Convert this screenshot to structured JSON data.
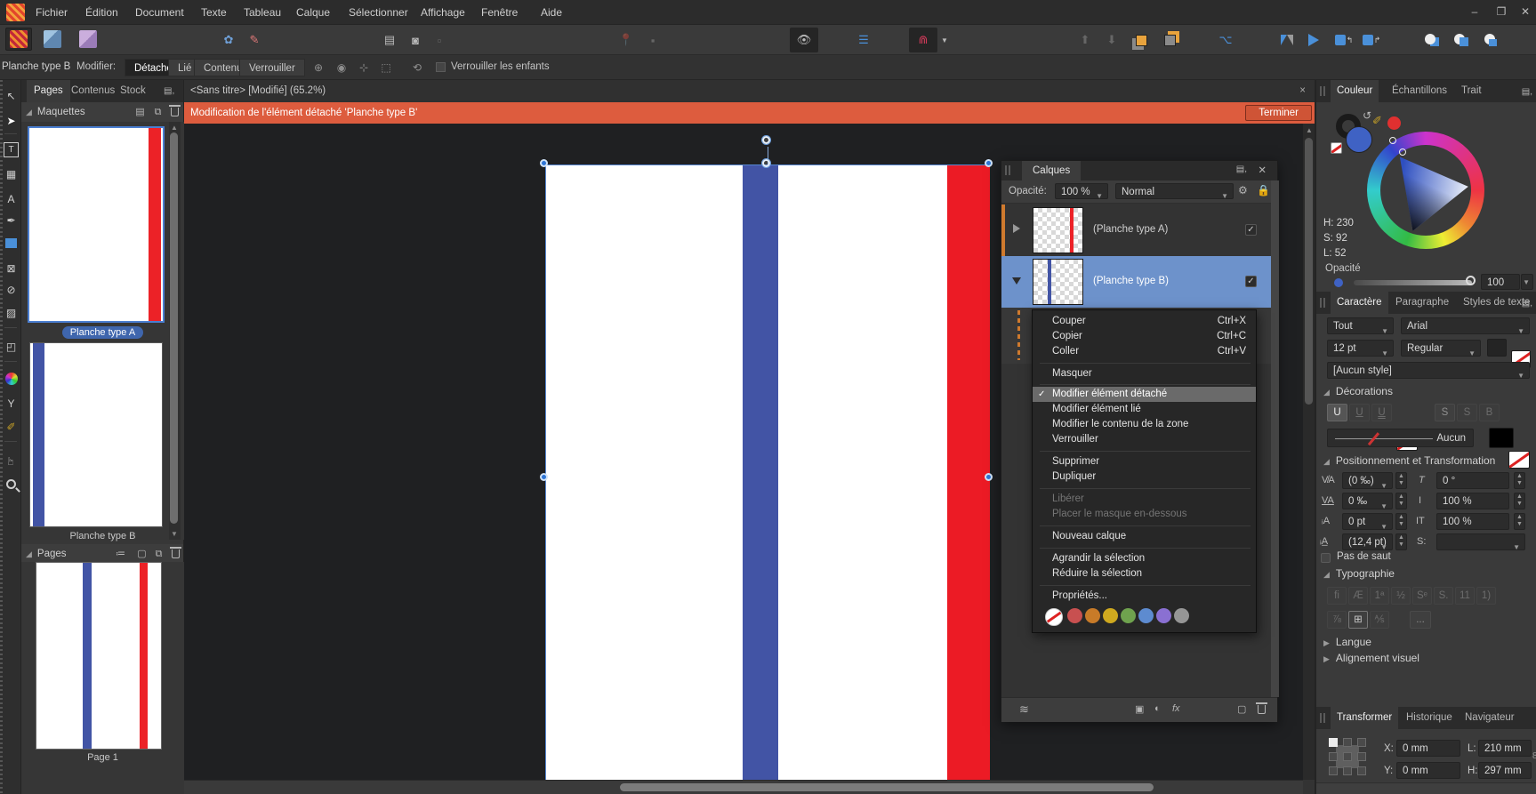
{
  "menubar": {
    "items": [
      "Fichier",
      "Édition",
      "Document",
      "Texte",
      "Tableau",
      "Calque",
      "Sélectionner",
      "Affichage",
      "Fenêtre",
      "Aide"
    ]
  },
  "window_controls": {
    "minimize": "–",
    "restore": "❐",
    "close": "✕"
  },
  "context_toolbar": {
    "title": "Planche type B",
    "modifier_label": "Modifier:",
    "detache": "Détaché",
    "lie": "Lié",
    "contenu": "Contenu",
    "verrouiller": "Verrouiller",
    "lock_children": "Verrouiller les enfants"
  },
  "left_panel": {
    "tabs": [
      "Pages",
      "Contenus",
      "Stock"
    ],
    "maquettes_title": "Maquettes",
    "master_a": "Planche type A",
    "master_b": "Planche type B",
    "pages_title": "Pages",
    "page1": "Page 1"
  },
  "document": {
    "tab_title": "<Sans titre> [Modifié] (65.2%)",
    "banner_text": "Modification de l'élément détaché 'Planche type B'",
    "banner_button": "Terminer"
  },
  "layers_panel": {
    "title": "Calques",
    "opacity_label": "Opacité:",
    "opacity_value": "100 %",
    "blend_mode": "Normal",
    "layer_a": "(Planche type A)",
    "layer_b": "(Planche type B)"
  },
  "context_menu": {
    "couper": "Couper",
    "couper_shortcut": "Ctrl+X",
    "copier": "Copier",
    "copier_shortcut": "Ctrl+C",
    "coller": "Coller",
    "coller_shortcut": "Ctrl+V",
    "masquer": "Masquer",
    "modifier_detache": "Modifier élément détaché",
    "modifier_lie": "Modifier élément lié",
    "modifier_contenu": "Modifier le contenu de la zone",
    "verrouiller": "Verrouiller",
    "supprimer": "Supprimer",
    "dupliquer": "Dupliquer",
    "liberer": "Libérer",
    "placer_masque": "Placer le masque en-dessous",
    "nouveau_calque": "Nouveau calque",
    "agrandir": "Agrandir la sélection",
    "reduire": "Réduire la sélection",
    "proprietes": "Propriétés...",
    "tag_colors": [
      "#c85050",
      "#c87b28",
      "#cfa91f",
      "#6fa24e",
      "#5d8bd0",
      "#8a70d2",
      "#969696"
    ]
  },
  "color_panel": {
    "tabs": [
      "Couleur",
      "Échantillons",
      "Trait"
    ],
    "h": "H: 230",
    "s": "S: 92",
    "l": "L: 52",
    "opacity_label": "Opacité",
    "opacity_value": "100 %"
  },
  "character_panel": {
    "tabs": [
      "Caractère",
      "Paragraphe",
      "Styles de texte"
    ],
    "collection": "Tout",
    "font": "Arial",
    "size": "12 pt",
    "weight": "Regular",
    "style": "[Aucun style]",
    "decorations_title": "Décorations",
    "underline": "U",
    "strike1": "S",
    "strike2": "S",
    "strike3": "B",
    "aucun": "Aucun",
    "positioning_title": "Positionnement et Transformation",
    "kerning": "(0 ‰)",
    "tracking": "0 ‰",
    "baseline": "0 pt",
    "leading": "(12,4 pt)",
    "shear": "0 °",
    "hscale": "100 %",
    "vscale": "100 %",
    "s_label": "S:",
    "pas_de_saut": "Pas de saut",
    "typographie_title": "Typographie",
    "langue_title": "Langue",
    "alignement_title": "Alignement visuel",
    "typo_buttons": [
      "fi",
      "Æ",
      "1ª",
      "½",
      "Sᵉ",
      "S.",
      "11",
      "1)"
    ],
    "typo_buttons2": [
      "⅞",
      "⊞",
      "⅍"
    ],
    "more": "..."
  },
  "transform_panel": {
    "tabs": [
      "Transformer",
      "Historique",
      "Navigateur"
    ],
    "x_label": "X:",
    "x": "0 mm",
    "y_label": "Y:",
    "y": "0 mm",
    "l_label": "L:",
    "l": "210 mm",
    "h_label": "H:",
    "h": "297 mm"
  },
  "colors": {
    "stripe_blue": "#4254a5",
    "stripe_red": "#ec1b25",
    "banner": "#dd5c3e",
    "selection": "#4a7ed0",
    "layer_selected": "#6d92cb",
    "thumb_red": "#ec2227",
    "thumb_blue": "#4254a5"
  },
  "tools": [
    {
      "name": "move-tool",
      "glyph": "↖"
    },
    {
      "name": "node-tool",
      "glyph": "➤"
    },
    {
      "name": "frame-text-tool",
      "glyph": "T"
    },
    {
      "name": "table-tool",
      "glyph": "▦"
    },
    {
      "name": "artistic-text-tool",
      "glyph": "A"
    },
    {
      "name": "pen-tool",
      "glyph": "✒"
    },
    {
      "name": "picture-frame-tool",
      "glyph": "⊠"
    },
    {
      "name": "ellipse-tool",
      "glyph": "⊘"
    },
    {
      "name": "image-tool",
      "glyph": "▨"
    },
    {
      "name": "crop-tool",
      "glyph": "◰"
    },
    {
      "name": "transparency-tool",
      "glyph": "Y"
    },
    {
      "name": "eyedropper-tool",
      "glyph": "✐"
    },
    {
      "name": "hand-tool",
      "glyph": "☞"
    }
  ]
}
